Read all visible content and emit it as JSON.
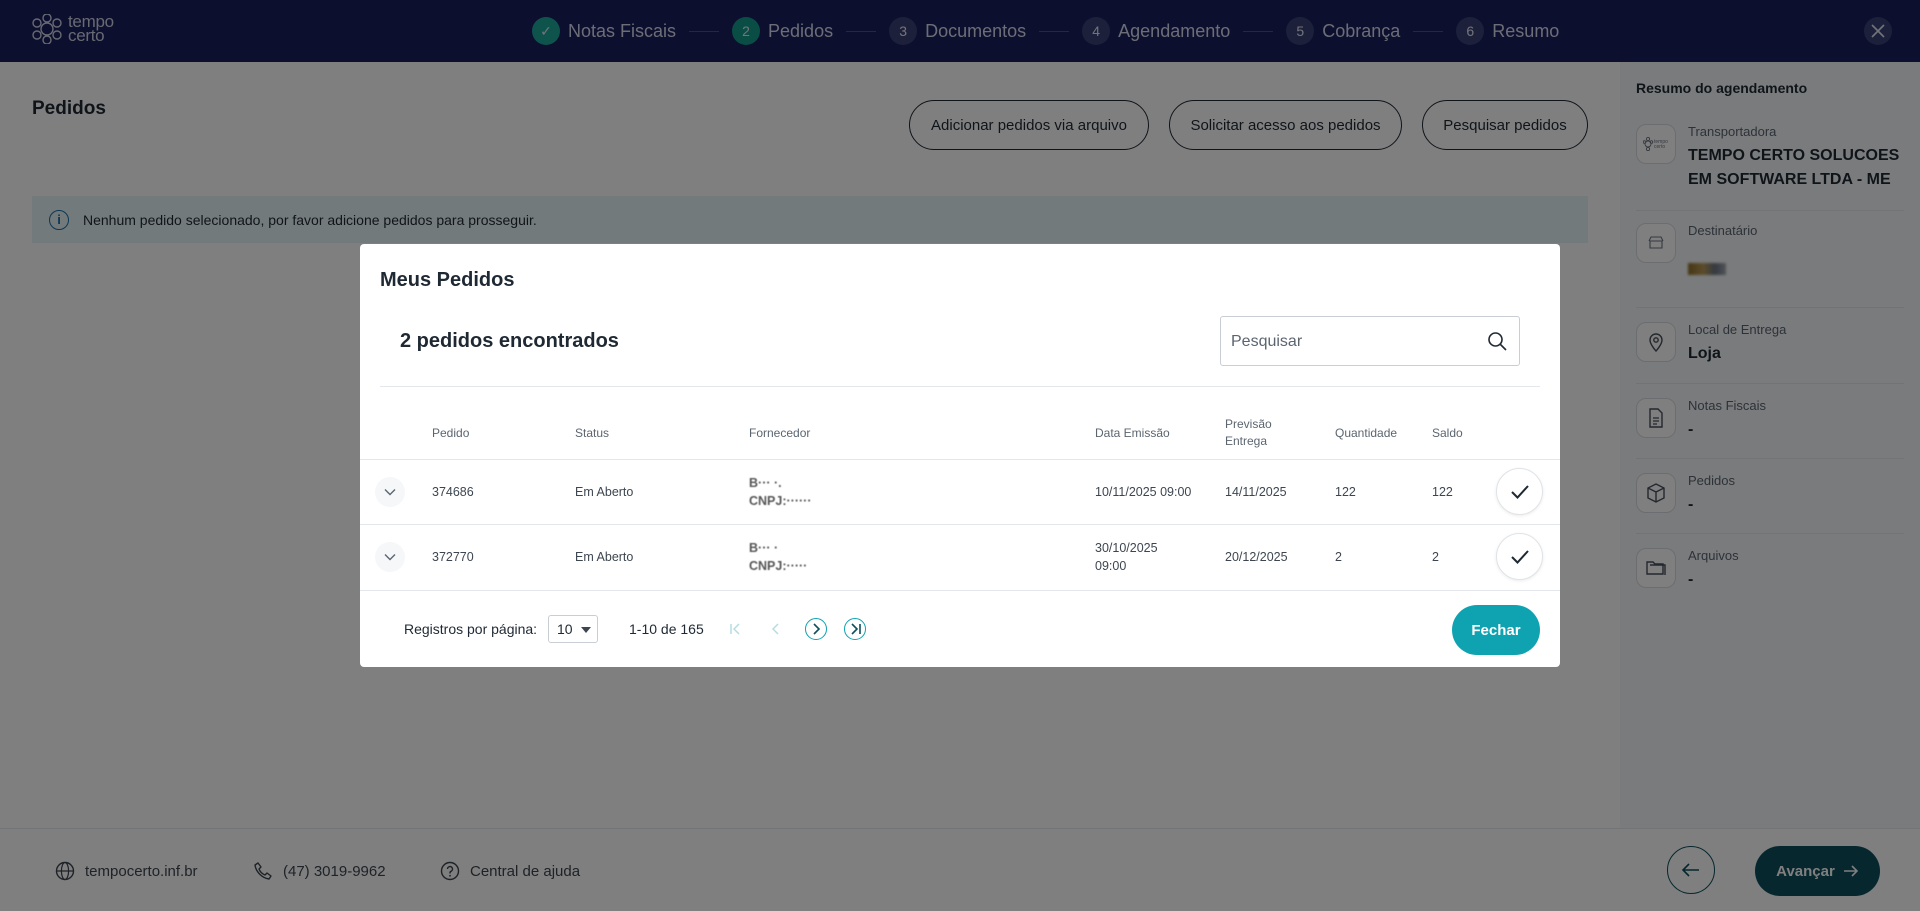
{
  "brand": {
    "logo_text_line1": "tempo",
    "logo_text_line2": "certo"
  },
  "steps": [
    {
      "num": "✓",
      "label": "Notas Fiscais"
    },
    {
      "num": "2",
      "label": "Pedidos"
    },
    {
      "num": "3",
      "label": "Documentos"
    },
    {
      "num": "4",
      "label": "Agendamento"
    },
    {
      "num": "5",
      "label": "Cobrança"
    },
    {
      "num": "6",
      "label": "Resumo"
    }
  ],
  "page": {
    "title": "Pedidos",
    "actions": {
      "add_file": "Adicionar pedidos via arquivo",
      "request_access": "Solicitar acesso aos pedidos",
      "search_orders": "Pesquisar pedidos"
    },
    "alert": "Nenhum pedido selecionado, por favor adicione pedidos para prosseguir."
  },
  "summary": {
    "title": "Resumo do agendamento",
    "items": [
      {
        "label": "Transportadora",
        "value": "TEMPO CERTO SOLUCOES EM SOFTWARE LTDA - ME",
        "icon": "tempo-certo-logo-icon"
      },
      {
        "label": "Destinatário",
        "value": "",
        "icon": "store-icon"
      },
      {
        "label": "Local de Entrega",
        "value": "Loja",
        "icon": "location-pin-icon"
      },
      {
        "label": "Notas Fiscais",
        "value": "-",
        "icon": "document-icon"
      },
      {
        "label": "Pedidos",
        "value": "-",
        "icon": "box-icon"
      },
      {
        "label": "Arquivos",
        "value": "-",
        "icon": "folder-icon"
      }
    ]
  },
  "footer": {
    "website": "tempocerto.inf.br",
    "phone": "(47) 3019-9962",
    "help": "Central de ajuda",
    "next_label": "Avançar"
  },
  "modal": {
    "title": "Meus Pedidos",
    "count_text": "2 pedidos encontrados",
    "search_placeholder": "Pesquisar",
    "columns": {
      "pedido": "Pedido",
      "status": "Status",
      "fornecedor": "Fornecedor",
      "data_emissao": "Data Emissão",
      "previsao_entrega": "Previsão Entrega",
      "quantidade": "Quantidade",
      "saldo": "Saldo"
    },
    "rows": [
      {
        "pedido": "374686",
        "status": "Em Aberto",
        "fornecedor_line1": "B··· ·.",
        "fornecedor_line2": "CNPJ:······",
        "data_emissao": "10/11/2025 09:00",
        "previsao_entrega": "14/11/2025",
        "quantidade": "122",
        "saldo": "122"
      },
      {
        "pedido": "372770",
        "status": "Em Aberto",
        "fornecedor_line1": "B··· ·",
        "fornecedor_line2": "CNPJ:·····",
        "data_emissao": "30/10/2025 09:00",
        "previsao_entrega": "20/12/2025",
        "quantidade": "2",
        "saldo": "2"
      }
    ],
    "pagination": {
      "per_page_label": "Registros por página:",
      "per_page_value": "10",
      "range_text": "1-10 de 165"
    },
    "close_label": "Fechar"
  }
}
